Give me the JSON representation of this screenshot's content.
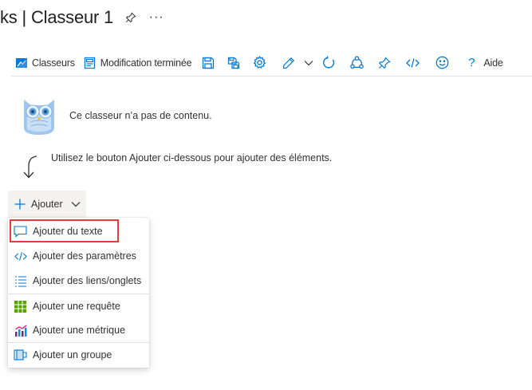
{
  "title": {
    "text": "ks | Classeur 1",
    "pin_icon": "pin-icon",
    "more_label": "···"
  },
  "toolbar": {
    "workbooks_label": "Classeurs",
    "edit_done_label": "Modification terminée",
    "help_label": "Aide",
    "icons": [
      "workbooks-icon",
      "done-editing-icon",
      "save-icon",
      "save-as-icon",
      "settings-icon",
      "edit-icon",
      "chevron-down-icon",
      "refresh-icon",
      "share-icon",
      "pin-icon",
      "code-icon",
      "feedback-icon",
      "help-icon"
    ]
  },
  "empty_state": {
    "message": "Ce classeur n’a pas de contenu.",
    "hint": "Utilisez le bouton Ajouter ci-dessous pour ajouter des éléments."
  },
  "add_button": {
    "label": "Ajouter"
  },
  "menu": {
    "items": [
      {
        "label": "Ajouter du texte",
        "icon": "text-icon",
        "highlighted": true
      },
      {
        "label": "Ajouter des paramètres",
        "icon": "parameters-icon"
      },
      {
        "label": "Ajouter des liens/onglets",
        "icon": "links-icon"
      },
      {
        "label": "Ajouter une requête",
        "icon": "query-grid-icon"
      },
      {
        "label": "Ajouter une métrique",
        "icon": "metric-chart-icon"
      },
      {
        "label": "Ajouter un groupe",
        "icon": "group-icon"
      }
    ]
  },
  "colors": {
    "accent": "#0078d4",
    "highlight_border": "#e8393b",
    "query_icon": "#57a300",
    "metric_icon": "#5c2e91"
  }
}
